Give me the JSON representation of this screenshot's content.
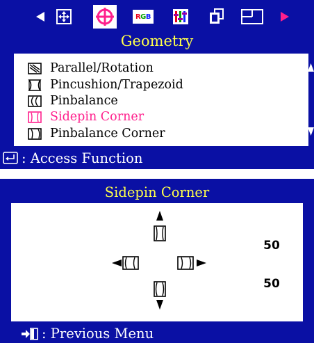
{
  "menu": {
    "icons": [
      "left-arrow-icon",
      "position-icon",
      "geometry-icon",
      "rgb-icon",
      "color-bars-icon",
      "windows-icon",
      "layout-icon",
      "right-arrow-icon"
    ],
    "rgb_icon_text": "RGB",
    "title": "Geometry",
    "items": [
      {
        "label": "Parallel/Rotation",
        "icon": "parallel-rotation-icon",
        "selected": false
      },
      {
        "label": "Pincushion/Trapezoid",
        "icon": "pincushion-trapezoid-icon",
        "selected": false
      },
      {
        "label": "Pinbalance",
        "icon": "pinbalance-icon",
        "selected": false
      },
      {
        "label": "Sidepin Corner",
        "icon": "sidepin-corner-icon",
        "selected": true
      },
      {
        "label": "Pinbalance Corner",
        "icon": "pinbalance-corner-icon",
        "selected": false
      }
    ],
    "footer_label": ": Access Function",
    "footer_icon": "enter-icon"
  },
  "adjust": {
    "title": "Sidepin Corner",
    "value_top": "50",
    "value_bottom": "50",
    "footer_label": ": Previous Menu",
    "footer_icon": "exit-icon"
  },
  "colors": {
    "panel": "#0a10a4",
    "title_text": "#ffff4a",
    "selected_text": "#ff1f8c",
    "selected_icon": "#ff1f8c"
  }
}
